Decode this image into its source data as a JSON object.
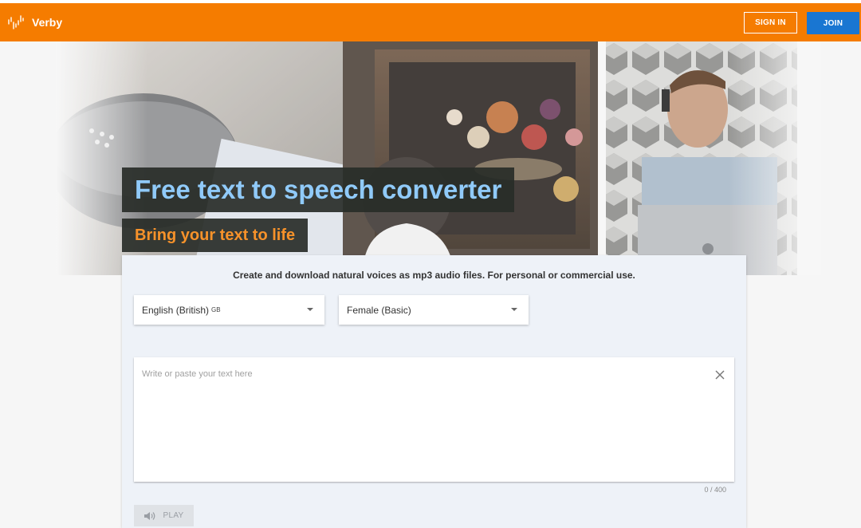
{
  "header": {
    "brand": "Verby",
    "sign_in_label": "SIGN IN",
    "join_label": "JOIN",
    "brand_color": "#f57c00",
    "join_color": "#1976d2"
  },
  "hero": {
    "title": "Free text to speech converter",
    "subtitle": "Bring your text to life"
  },
  "converter": {
    "tagline": "Create and download natural voices as mp3 audio files. For personal or commercial use.",
    "language_value": "English (British)",
    "language_flag": "GB",
    "voice_value": "Female (Basic)",
    "text_placeholder": "Write or paste your text here",
    "char_counter": "0 / 400",
    "play_label": "PLAY"
  },
  "icons": {
    "logo": "waveform-icon",
    "clear": "close-icon",
    "play": "speaker-icon",
    "dropdown": "caret-down-icon"
  }
}
